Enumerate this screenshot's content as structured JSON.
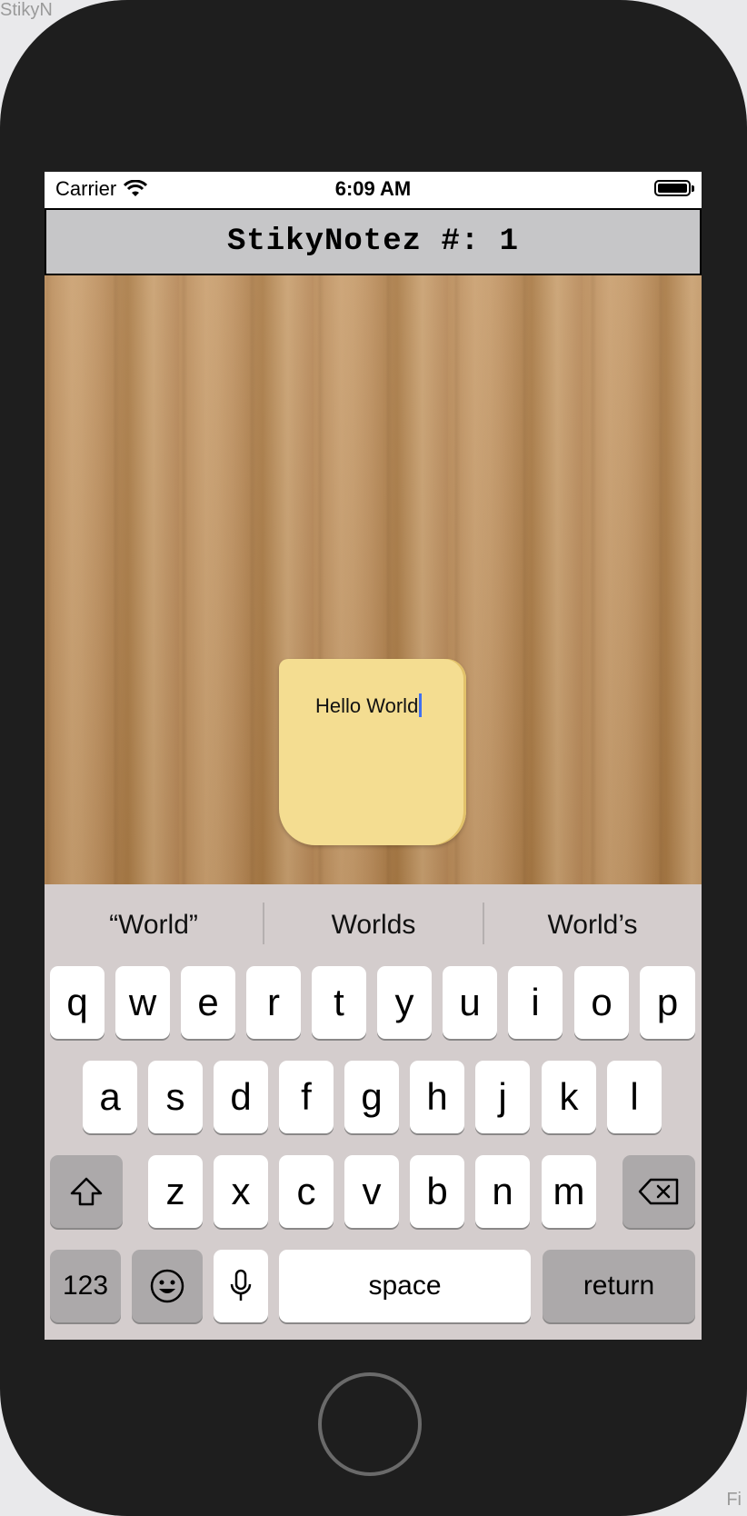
{
  "background_window": {
    "title_fragment": "StikyN",
    "corner_fragment": "Fi"
  },
  "status_bar": {
    "carrier": "Carrier",
    "time": "6:09 AM"
  },
  "nav": {
    "title": "StikyNotez #: 1"
  },
  "note": {
    "text": "Hello World"
  },
  "suggestions": [
    "“World”",
    "Worlds",
    "World’s"
  ],
  "keyboard": {
    "row1": [
      "q",
      "w",
      "e",
      "r",
      "t",
      "y",
      "u",
      "i",
      "o",
      "p"
    ],
    "row2": [
      "a",
      "s",
      "d",
      "f",
      "g",
      "h",
      "j",
      "k",
      "l"
    ],
    "row3": [
      "z",
      "x",
      "c",
      "v",
      "b",
      "n",
      "m"
    ],
    "numbers_key": "123",
    "space_key": "space",
    "return_key": "return"
  }
}
